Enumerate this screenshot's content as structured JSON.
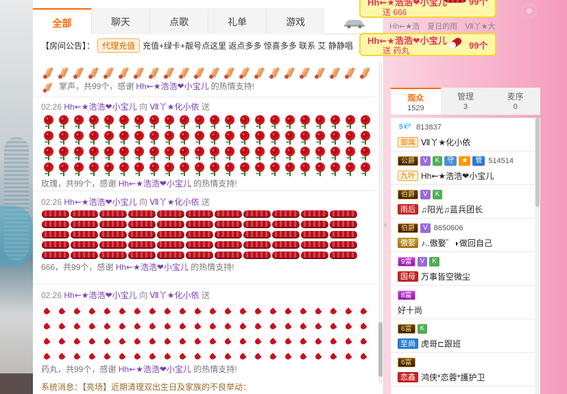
{
  "tabs": [
    {
      "label": "全部",
      "active": true
    },
    {
      "label": "聊天",
      "active": false
    },
    {
      "label": "点歌",
      "active": false
    },
    {
      "label": "礼单",
      "active": false
    },
    {
      "label": "游戏",
      "active": false
    }
  ],
  "notice": {
    "label": "【房间公告】：",
    "agent_button": "代理充值",
    "text": "充值+绿卡+靓号点这里 返点多多 惊喜多多 联系 艾 静静唱"
  },
  "messages": [
    {
      "gift": "clap",
      "count_rows": 1,
      "summary_prefix": "掌声，共99个，感谢",
      "summary_nick": "Hh⇜★浩浩❤小宝儿",
      "summary_suffix": "的热情支持!"
    },
    {
      "gift": "rose",
      "time": "02:26",
      "from": "Hh⇜★浩浩❤小宝儿",
      "to_word": "向",
      "to": "Ⅶ丫★化小依",
      "send_word": "送",
      "summary_prefix": "玫瑰，共99个，感谢",
      "summary_nick": "Hh⇜★浩浩❤小宝儿",
      "summary_suffix": "的热情支持!"
    },
    {
      "gift": "666",
      "time": "02:26",
      "from": "Hh⇜★浩浩❤小宝儿",
      "to_word": "向",
      "to": "Ⅶ丫★化小依",
      "send_word": "送",
      "summary_prefix": "666，共99个，感谢",
      "summary_nick": "Hh⇜★浩浩❤小宝儿",
      "summary_suffix": "的热情支持!"
    },
    {
      "gift": "pill",
      "time": "02:26",
      "from": "Hh⇜★浩浩❤小宝儿",
      "to_word": "向",
      "to": "Ⅶ丫★化小依",
      "send_word": "送",
      "summary_prefix": "药丸，共99个，感谢",
      "summary_nick": "Hh⇜★浩浩❤小宝儿",
      "summary_suffix": "的热情支持!"
    }
  ],
  "bottom_text": "系统消息：【亮场】近期清理双出生日及家族的不良举动：",
  "gift_banners": [
    {
      "line1": "Hh⇜★浩浩❤小宝儿",
      "line2": "送 666",
      "count": "99个"
    },
    {
      "line1": "Hh⇜★浩浩❤小宝儿",
      "line2": "送 药丸",
      "count": "99个"
    }
  ],
  "top_users": [
    "Hh⇜★浩",
    "夏日的雨",
    "Ⅶ丫★大"
  ],
  "audience_tabs": [
    {
      "label": "观众",
      "count": "1529",
      "active": true
    },
    {
      "label": "管理",
      "count": "3",
      "active": false
    },
    {
      "label": "麦序",
      "count": "0",
      "active": false
    }
  ],
  "users": [
    {
      "badges": [
        {
          "t": "5💎",
          "c": "diamond"
        }
      ],
      "uid": "813837",
      "tag": {
        "t": "御属",
        "c": "orange"
      },
      "name": "Ⅶ丫★化小依"
    },
    {
      "badges": [
        {
          "t": "公爵",
          "c": "rank"
        },
        {
          "t": "V",
          "c": "v"
        },
        {
          "t": "K",
          "c": "k"
        },
        {
          "t": "守",
          "c": "s"
        },
        {
          "t": "★",
          "c": "star"
        },
        {
          "t": "管",
          "c": "g"
        }
      ],
      "uid": "514514",
      "tag": {
        "t": "九叶",
        "c": "orange"
      },
      "name": "Hh⇜★浩浩❤小宝儿"
    },
    {
      "badges": [
        {
          "t": "伯爵",
          "c": "rank"
        },
        {
          "t": "V",
          "c": "v"
        },
        {
          "t": "K",
          "c": "k"
        }
      ],
      "uid": "",
      "tag": {
        "t": "雨后",
        "c": "red"
      },
      "name": "♫阳光♫蓝兵团长"
    },
    {
      "badges": [
        {
          "t": "伯爵",
          "c": "rank"
        },
        {
          "t": "V",
          "c": "v"
        }
      ],
      "uid": "8650606",
      "tag": {
        "t": "傲娶",
        "c": "gold"
      },
      "name": "♪..傲娶゛◗做回自己"
    },
    {
      "badges": [
        {
          "t": "9富",
          "c": "rank p"
        },
        {
          "t": "V",
          "c": "v"
        },
        {
          "t": "K",
          "c": "k"
        }
      ],
      "uid": "",
      "tag": {
        "t": "国母",
        "c": "red"
      },
      "name": "万事皆空微尘"
    },
    {
      "badges": [
        {
          "t": "8富",
          "c": "rank p"
        }
      ],
      "uid": "",
      "tag": null,
      "name": "好十尚"
    },
    {
      "badges": [
        {
          "t": "6富",
          "c": "rank"
        },
        {
          "t": "K",
          "c": "k"
        }
      ],
      "uid": "",
      "tag": {
        "t": "至尚",
        "c": "blue"
      },
      "name": "虎哥⊏跟班"
    },
    {
      "badges": [
        {
          "t": "6富",
          "c": "rank"
        }
      ],
      "uid": "",
      "tag": {
        "t": "恋鑫",
        "c": "red"
      },
      "name": "鸿侠*恋蓉*護护卫"
    }
  ]
}
